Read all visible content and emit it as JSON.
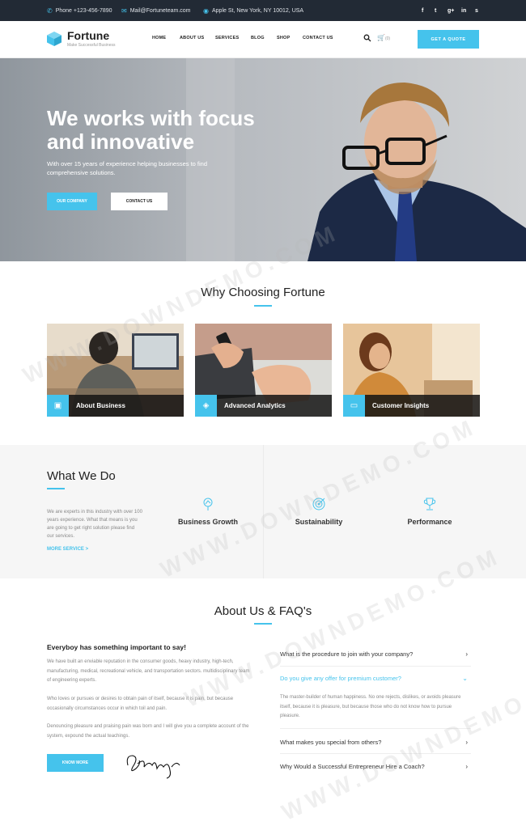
{
  "topbar": {
    "phone": "Phone +123-456-7890",
    "email": "Mail@Fortuneteam.com",
    "address": "Apple St, New York, NY 10012, USA",
    "social": [
      "f",
      "t",
      "g+",
      "in",
      "s"
    ]
  },
  "header": {
    "logo_name": "Fortune",
    "logo_tagline": "Make Successful Business",
    "nav": [
      "HOME",
      "ABOUT US",
      "SERVICES",
      "BLOG",
      "SHOP",
      "CONTACT US"
    ],
    "cart_count": "(0)",
    "quote_button": "GET A QUOTE"
  },
  "hero": {
    "title": "We works with focus and innovative",
    "subtitle": "With over 15 years of experience helping businesses to find comprehensive solutions.",
    "button_primary": "OUR COMPANY",
    "button_secondary": "CONTACT US"
  },
  "why": {
    "title": "Why Choosing Fortune",
    "cards": [
      {
        "label": "About Business",
        "icon": "presentation-icon"
      },
      {
        "label": "Advanced Analytics",
        "icon": "layers-icon"
      },
      {
        "label": "Customer Insights",
        "icon": "monitor-icon"
      }
    ]
  },
  "whatwedo": {
    "title": "What We Do",
    "text": "We are experts in this industry with over 100 years experience. What that means is you are going to get right solution please find our services.",
    "more": "MORE SERVICE >",
    "features": [
      "Business Growth",
      "Sustainability",
      "Performance"
    ]
  },
  "about": {
    "title": "About Us & FAQ's",
    "heading": "Everyboy has something important to say!",
    "paragraphs": [
      "We have built an enviable reputation in the consumer goods, heavy industry, high-tech, manufacturing, medical, recreational vehicle, and transportation sectors. multidisciplinary team of engineering experts.",
      "Who loves or pursues or desires to obtain pain of itself, because it is pain, but because occasionally circumstances occur in which toil and pain.",
      "Denouncing pleasure and praising pain was born and I will give you a complete account of the system, expound the actual teachings."
    ],
    "button": "KNOW MORE",
    "faqs": [
      "What is the procedure to join with your company?",
      "Do you give any offer for premium customer?",
      "What makes you special from others?",
      "Why Would a Successful Entrepreneur Hire a Coach?"
    ],
    "faq_answer": "The master-builder of human happiness. No one rejects, dislikes, or avoids pleasure itself, because it is pleasure, but because those who do not know how to pursue pleasure."
  },
  "watermark": "WWW.DOWNDEMO.COM",
  "colors": {
    "accent": "#45c3ec",
    "topbar": "#222a35",
    "dark": "#222222"
  }
}
